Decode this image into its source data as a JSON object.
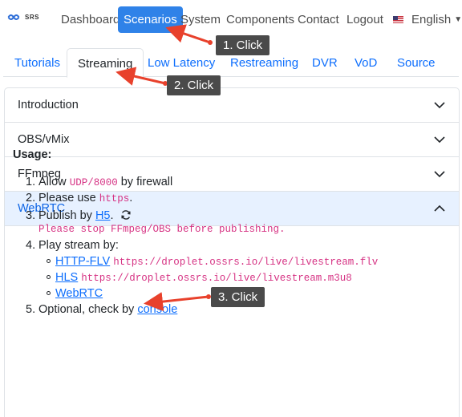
{
  "brand": {
    "name": "SRS",
    "logo_icon": "srs-logo-icon"
  },
  "nav": {
    "items": [
      "Dashboard",
      "Scenarios",
      "System",
      "Components",
      "Contact",
      "Logout"
    ],
    "active": "Scenarios",
    "language": "English",
    "language_flag": "us-flag-icon"
  },
  "tabs": {
    "items": [
      "Tutorials",
      "Streaming",
      "Low Latency",
      "Restreaming",
      "DVR",
      "VoD",
      "Source"
    ],
    "active": "Streaming"
  },
  "accordion": {
    "items": [
      "Introduction",
      "OBS/vMix",
      "FFmpeg",
      "WebRTC"
    ],
    "open": "WebRTC"
  },
  "usage": {
    "title": "Usage:",
    "step1": {
      "num": "1.",
      "pre": "Allow",
      "code": "UDP/8000",
      "post": "by firewall"
    },
    "step2": {
      "num": "2.",
      "pre": "Please use",
      "code": "https",
      "post": "."
    },
    "step3": {
      "num": "3.",
      "pre": "Publish by",
      "link": "H5",
      "post": ".",
      "warning": "Please stop FFmpeg/OBS before publishing."
    },
    "step4": {
      "num": "4.",
      "text": "Play stream by:",
      "links": [
        {
          "label": "HTTP-FLV",
          "url": "https://droplet.ossrs.io/live/livestream.flv"
        },
        {
          "label": "HLS",
          "url": "https://droplet.ossrs.io/live/livestream.m3u8"
        },
        {
          "label": "WebRTC",
          "url": ""
        }
      ]
    },
    "step5": {
      "num": "5.",
      "pre": "Optional, check by",
      "link": "console"
    }
  },
  "annotations": [
    "1. Click",
    "2. Click",
    "3. Click"
  ],
  "colors": {
    "accent": "#2f82e8",
    "link": "#0d6efd",
    "code": "#d63384",
    "arrow": "#e8412c",
    "callout": "#4a4a4a"
  }
}
